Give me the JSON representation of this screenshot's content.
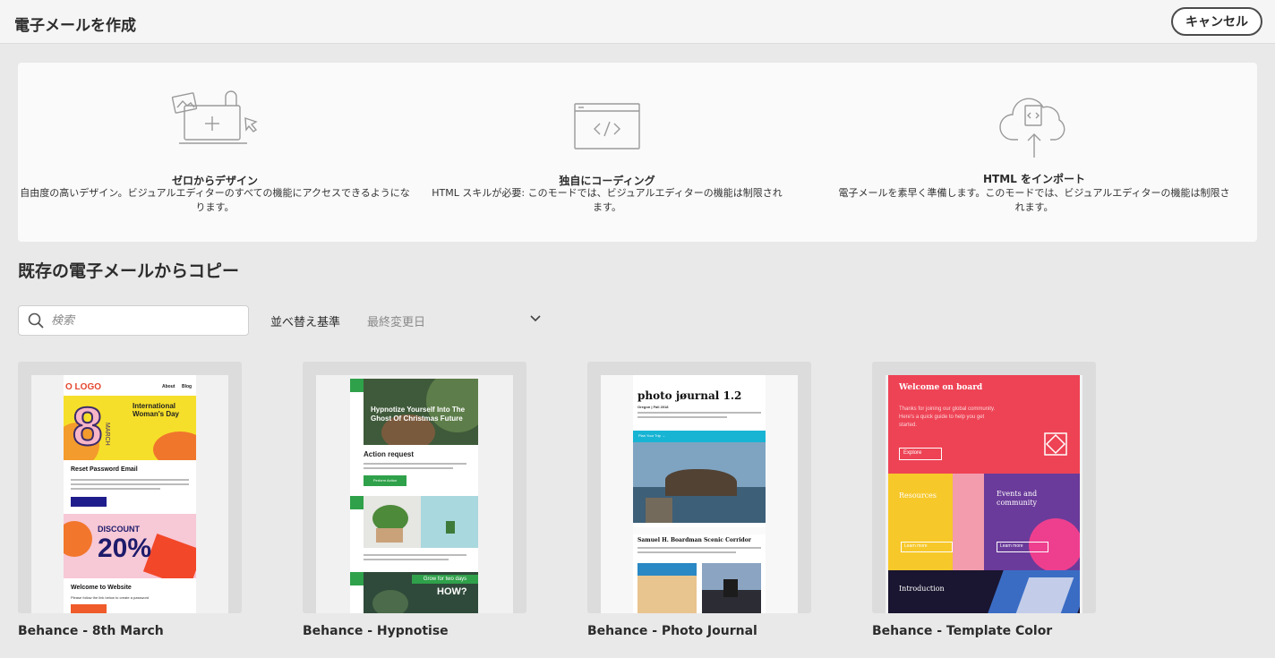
{
  "header": {
    "title": "電子メールを作成",
    "cancel_label": "キャンセル"
  },
  "options": [
    {
      "title": "ゼロからデザイン",
      "desc_line1": "自由度の高いデザイン。ビジュアルエディターのすべての機能にアクセスできるようにな",
      "desc_line2": "ります。"
    },
    {
      "title": "独自にコーディング",
      "desc_line1": "HTML スキルが必要: このモードでは、ビジュアルエディターの機能は制限され",
      "desc_line2": "ます。"
    },
    {
      "title": "HTML をインポート",
      "desc_line1": "電子メールを素早く準備します。このモードでは、ビジュアルエディターの機能は制限さ",
      "desc_line2": "れます。"
    }
  ],
  "copy_section": {
    "title": "既存の電子メールからコピー",
    "search_placeholder": "検索",
    "sort_label": "並べ替え基準",
    "sort_value": "最終変更日"
  },
  "templates": [
    {
      "name": "Behance - 8th March",
      "preview": {
        "logo": "O LOGO",
        "nav1": "About",
        "nav2": "Blog",
        "big_number": "8",
        "month": "MARCH",
        "headline": "International Woman's Day",
        "h1": "Reset Password Email",
        "discount": "DISCOUNT",
        "percent": "20%",
        "h2": "Welcome to Website",
        "body2": "Please follow the link below to create a password"
      }
    },
    {
      "name": "Behance - Hypnotise",
      "preview": {
        "headline": "Hypnotize Yourself Into The Ghost Of Christmas Future",
        "h1": "Action request",
        "button": "Perform Action",
        "grow": "Grow for two days",
        "how": "HOW?"
      }
    },
    {
      "name": "Behance - Photo Journal",
      "preview": {
        "title": "photo jøurnal 1.2",
        "subtitle": "Oregon | Fall 2018",
        "cta": "Plan Your Trip →",
        "caption": "Samuel H. Boardman Scenic Corridor"
      }
    },
    {
      "name": "Behance - Template Color",
      "preview": {
        "welcome": "Welcome on board",
        "intro": "Thanks for joining our global community. Here's a quick guide to help you get started.",
        "explore": "Explore",
        "resources": "Resources",
        "events": "Events and community",
        "learn1": "Learn more",
        "learn2": "Learn more",
        "introduction": "Introduction"
      }
    }
  ],
  "colors": {
    "background": "#e9e9e9",
    "panel": "#fafafa",
    "accent_pink": "#e8445a",
    "accent_yellow": "#f2d231"
  }
}
